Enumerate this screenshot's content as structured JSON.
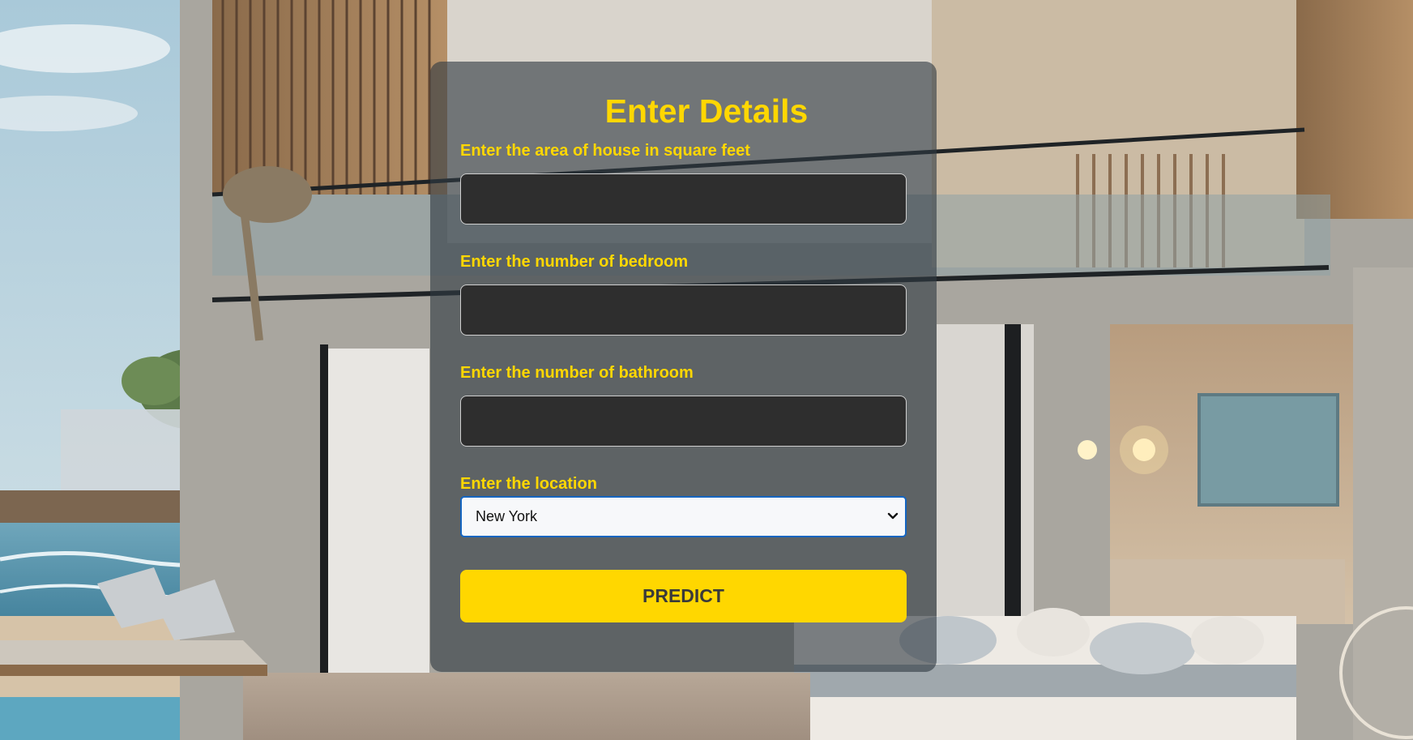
{
  "form": {
    "title": "Enter Details",
    "fields": [
      {
        "label": "Enter the area of house in square feet",
        "value": "",
        "placeholder": ""
      },
      {
        "label": "Enter the number of bedroom",
        "value": "",
        "placeholder": ""
      },
      {
        "label": "Enter the number of bathroom",
        "value": "",
        "placeholder": ""
      }
    ],
    "location": {
      "label": "Enter the location",
      "selected": "New York"
    },
    "submit_label": "PREDICT"
  },
  "colors": {
    "accent": "#FFD700",
    "input_bg": "#2e2e2e",
    "card_bg": "rgba(48,58,66,0.62)",
    "select_focus": "#1565c0"
  },
  "icons": {
    "select_arrow": "chevron-down-icon"
  }
}
